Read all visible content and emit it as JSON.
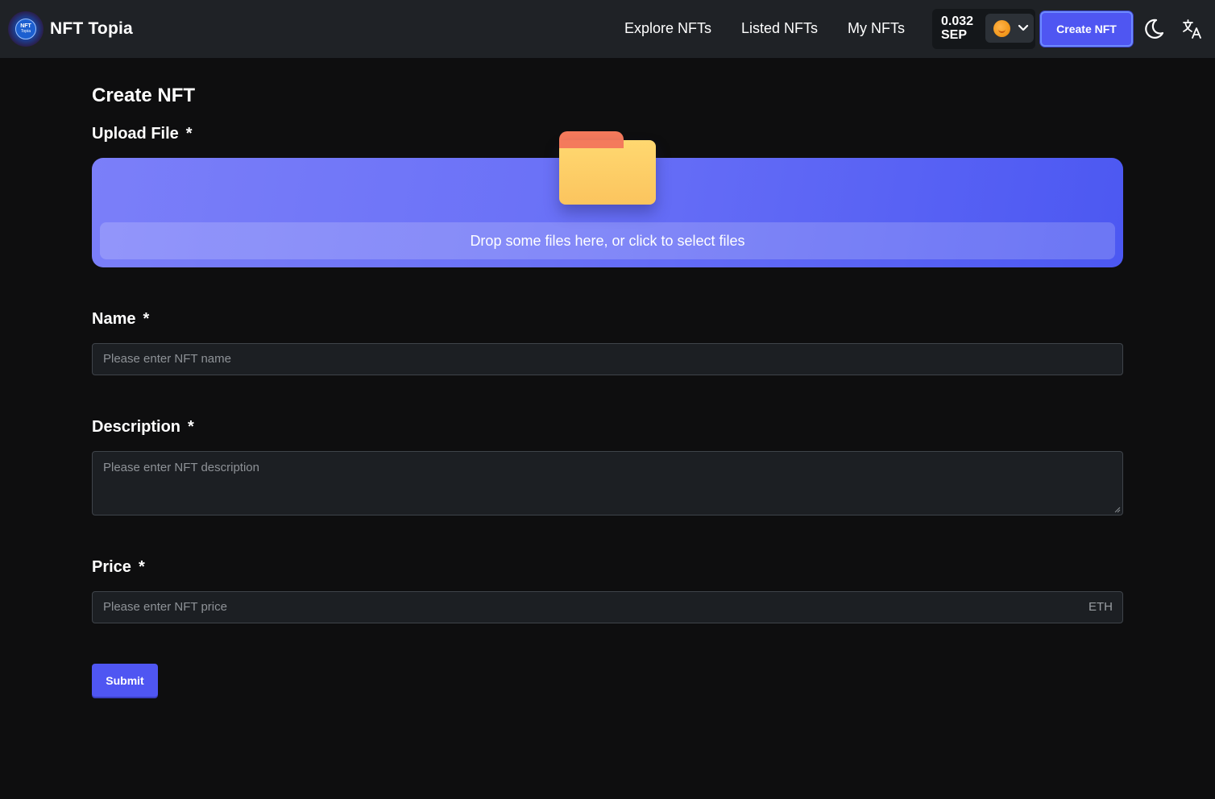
{
  "header": {
    "brand": "NFT Topia",
    "logo_text_top": "NFT",
    "logo_text_bottom": "Topia",
    "nav": [
      {
        "label": "Explore NFTs"
      },
      {
        "label": "Listed NFTs"
      },
      {
        "label": "My NFTs"
      }
    ],
    "wallet": {
      "balance_amount": "0.032",
      "balance_unit": "SEP"
    },
    "create_label": "Create NFT",
    "icons": {
      "theme": "moon-icon",
      "language": "translate-icon",
      "account_chevron": "chevron-down-icon"
    },
    "accent_color": "#4f56f2"
  },
  "form": {
    "title": "Create NFT",
    "upload": {
      "label": "Upload File",
      "required_mark": "*",
      "drop_text": "Drop some files here, or click to select files"
    },
    "name": {
      "label": "Name",
      "required_mark": "*",
      "placeholder": "Please enter NFT name"
    },
    "description": {
      "label": "Description",
      "required_mark": "*",
      "placeholder": "Please enter NFT description"
    },
    "price": {
      "label": "Price",
      "required_mark": "*",
      "placeholder": "Please enter NFT price",
      "suffix": "ETH"
    },
    "submit_label": "Submit"
  }
}
